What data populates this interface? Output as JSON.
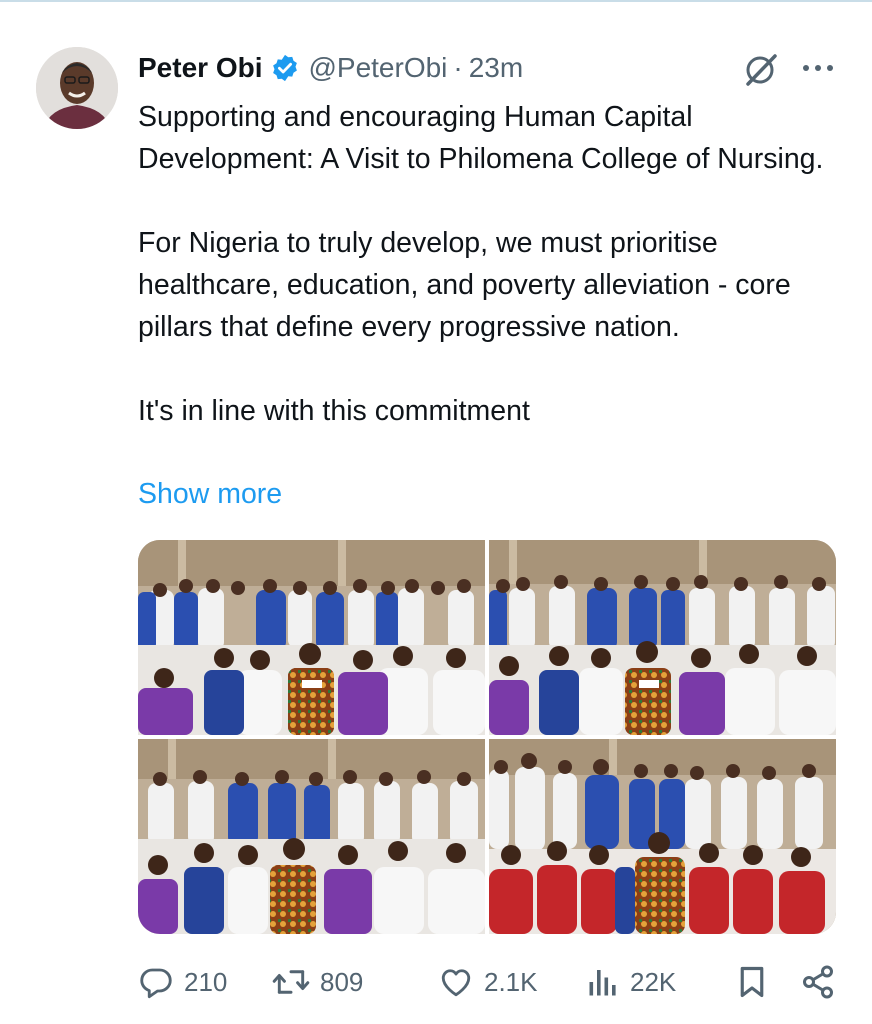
{
  "tweet": {
    "author": {
      "display_name": "Peter Obi",
      "handle": "@PeterObi",
      "verified_icon": "verified-badge-icon"
    },
    "separator": "·",
    "time": "23m",
    "text": {
      "p1": "Supporting and encouraging Human Capital Development: A Visit to Philomena College of Nursing.",
      "p2": "For Nigeria to truly develop, we must prioritise healthcare, education, and poverty alleviation - core pillars that define every progressive nation.",
      "p3": "It's in line with this commitment"
    },
    "show_more": "Show more",
    "media_count": 4
  },
  "actions": {
    "reply": {
      "icon": "reply-icon",
      "count": "210"
    },
    "retweet": {
      "icon": "retweet-icon",
      "count": "809"
    },
    "like": {
      "icon": "heart-icon",
      "count": "2.1K"
    },
    "views": {
      "icon": "views-chart-icon",
      "count": "22K"
    },
    "bookmark": {
      "icon": "bookmark-icon"
    },
    "share": {
      "icon": "share-icon"
    }
  },
  "colors": {
    "accent": "#1d9bf0",
    "muted": "#536471",
    "text": "#0f1419"
  }
}
